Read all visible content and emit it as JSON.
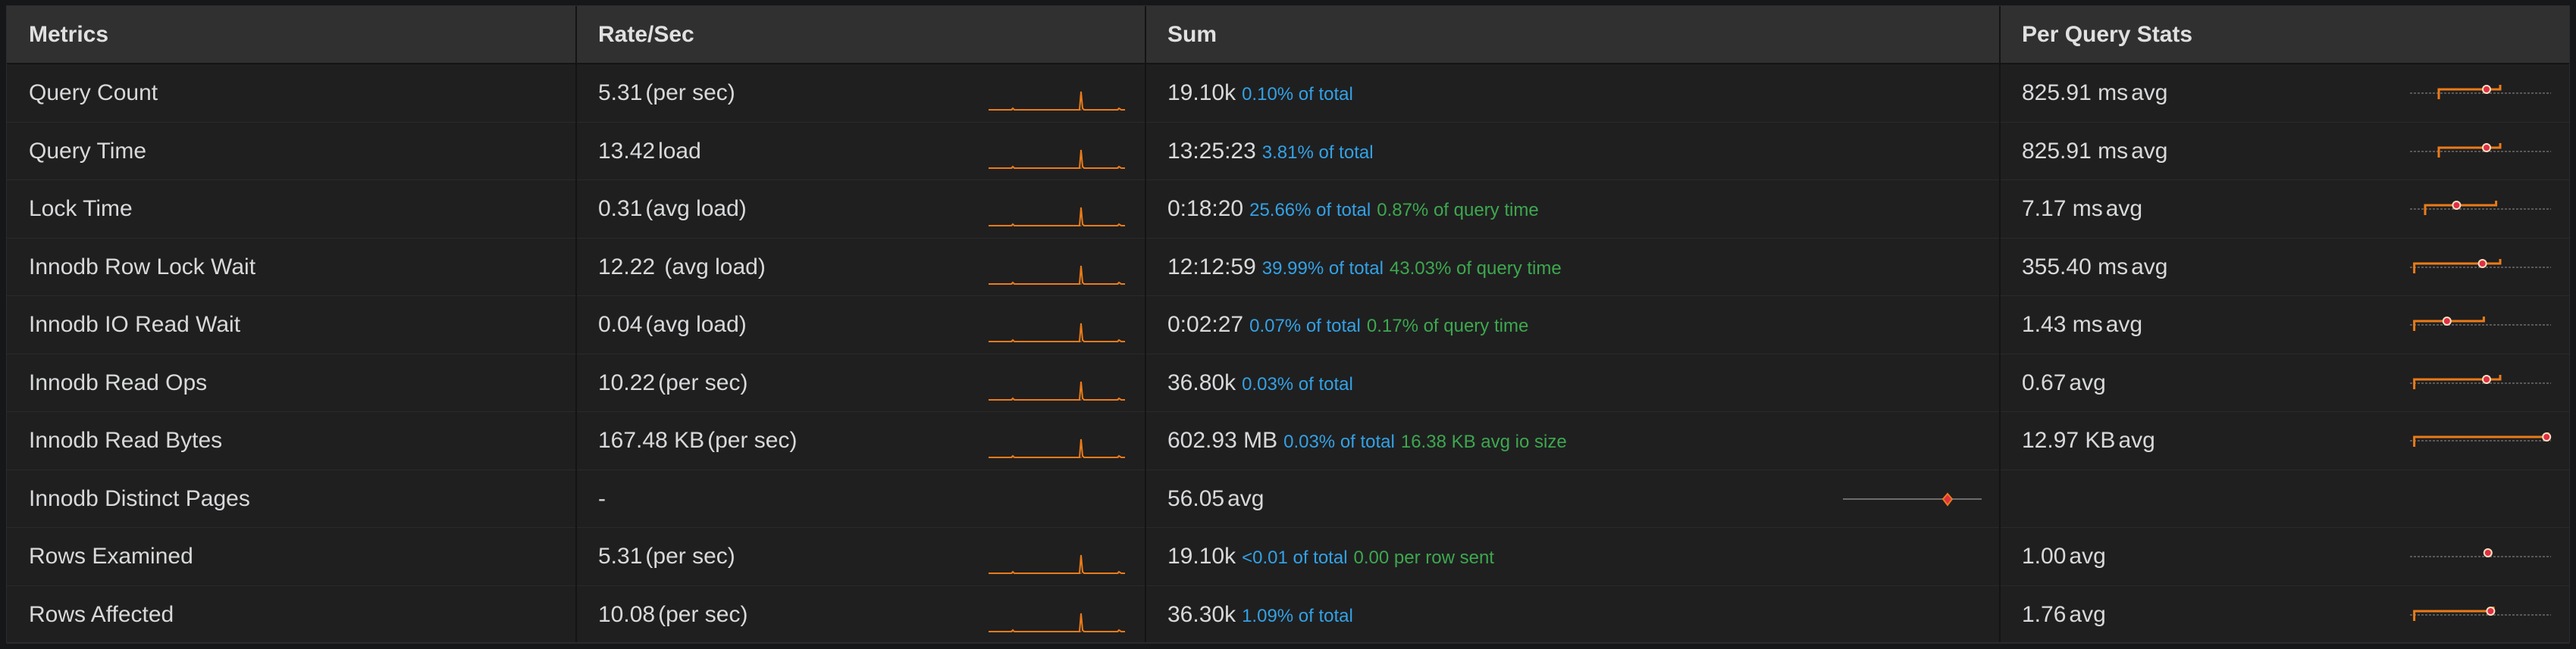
{
  "header": {
    "metrics": "Metrics",
    "rate": "Rate/Sec",
    "sum": "Sum",
    "per_query": "Per Query Stats"
  },
  "rows": [
    {
      "metric": "Query Count",
      "rate_value": "5.31",
      "rate_unit": "(per sec)",
      "sum_value": "19.10k",
      "sum_pct": "0.10% of total",
      "sum_extra": "",
      "pq_value": "825.91 ms",
      "pq_unit": "avg",
      "pq_range": [
        0.2,
        0.65,
        0.55
      ],
      "has_rate": true
    },
    {
      "metric": "Query Time",
      "rate_value": "13.42",
      "rate_unit": "load",
      "sum_value": "13:25:23",
      "sum_pct": "3.81% of total",
      "sum_extra": "",
      "pq_value": "825.91 ms",
      "pq_unit": "avg",
      "pq_range": [
        0.2,
        0.65,
        0.55
      ],
      "has_rate": true
    },
    {
      "metric": "Lock Time",
      "rate_value": "0.31",
      "rate_unit": "(avg load)",
      "sum_value": "0:18:20",
      "sum_pct": "25.66% of total",
      "sum_extra": "0.87% of query time",
      "pq_value": "7.17 ms",
      "pq_unit": "avg",
      "pq_range": [
        0.1,
        0.62,
        0.33
      ],
      "has_rate": true
    },
    {
      "metric": "Innodb Row Lock Wait",
      "rate_value": "12.22 ",
      "rate_unit": "(avg load)",
      "sum_value": "12:12:59",
      "sum_pct": "39.99% of total",
      "sum_extra": "43.03% of query time",
      "pq_value": "355.40 ms",
      "pq_unit": "avg",
      "pq_range": [
        0.02,
        0.65,
        0.52
      ],
      "has_rate": true
    },
    {
      "metric": "Innodb IO Read Wait",
      "rate_value": "0.04",
      "rate_unit": "(avg load)",
      "sum_value": "0:02:27",
      "sum_pct": "0.07% of total",
      "sum_extra": "0.17% of query time",
      "pq_value": "1.43 ms",
      "pq_unit": "avg",
      "pq_range": [
        0.02,
        0.53,
        0.26
      ],
      "has_rate": true
    },
    {
      "metric": "Innodb Read Ops",
      "rate_value": "10.22",
      "rate_unit": "(per sec)",
      "sum_value": "36.80k",
      "sum_pct": "0.03% of total",
      "sum_extra": "",
      "pq_value": "0.67",
      "pq_unit": "avg",
      "pq_range": [
        0.02,
        0.65,
        0.55
      ],
      "has_rate": true
    },
    {
      "metric": "Innodb Read Bytes",
      "rate_value": "167.48 KB",
      "rate_unit": "(per sec)",
      "sum_value": "602.93 MB",
      "sum_pct": "0.03% of total",
      "sum_extra": "16.38 KB avg io size",
      "pq_value": "12.97 KB",
      "pq_unit": "avg",
      "pq_range": [
        0.02,
        1.0,
        0.99
      ],
      "has_rate": true
    },
    {
      "metric": "Innodb Distinct Pages",
      "rate_value": "-",
      "rate_unit": "",
      "sum_value": "56.05",
      "sum_pct": "",
      "sum_extra": "",
      "pq_value": "",
      "pq_unit": "",
      "sum_unit": "avg",
      "has_rate": false
    },
    {
      "metric": "Rows Examined",
      "rate_value": "5.31",
      "rate_unit": "(per sec)",
      "sum_value": "19.10k",
      "sum_pct": "<0.01 of total",
      "sum_extra": "0.00 per row sent",
      "pq_value": "1.00",
      "pq_unit": "avg",
      "pq_range": [
        0.56,
        0.56,
        0.56
      ],
      "has_rate": true
    },
    {
      "metric": "Rows Affected",
      "rate_value": "10.08",
      "rate_unit": "(per sec)",
      "sum_value": "36.30k",
      "sum_pct": "1.09% of total",
      "sum_extra": "",
      "pq_value": "1.76",
      "pq_unit": "avg",
      "pq_range": [
        0.02,
        0.6,
        0.58
      ],
      "has_rate": true
    }
  ],
  "colors": {
    "accent": "#eb7b18",
    "blue": "#33a2e5",
    "green": "#3da84e",
    "marker": "#e02f44"
  }
}
